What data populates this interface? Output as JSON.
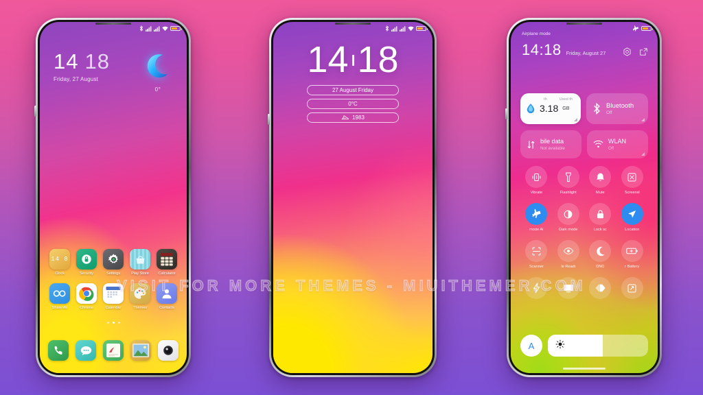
{
  "watermark": {
    "text": "VISIT  FOR  MORE  THEMES  -  MIUITHEMER.COM"
  },
  "statusbar": {
    "bluetooth": "bluetooth-icon",
    "signal1": "signal-icon",
    "signal2": "signal-icon",
    "wifi": "wifi-icon",
    "battery": "battery-icon"
  },
  "phone1": {
    "lockscreen": {
      "hours": "14",
      "minutes": "18",
      "date": "Friday, 27 August",
      "weather_icon": "crescent-moon-icon",
      "temperature": "0°"
    },
    "apps_row1": [
      {
        "label": "Clock",
        "icon": "clock-icon"
      },
      {
        "label": "Security",
        "icon": "security-lock-icon"
      },
      {
        "label": "Settings",
        "icon": "settings-gear-icon"
      },
      {
        "label": "Play Store",
        "icon": "play-store-icon"
      },
      {
        "label": "Calculator",
        "icon": "calculator-icon"
      }
    ],
    "apps_row2": [
      {
        "label": "ShareMe",
        "icon": "shareme-icon"
      },
      {
        "label": "Chrome",
        "icon": "chrome-icon"
      },
      {
        "label": "Calendar",
        "icon": "calendar-icon"
      },
      {
        "label": "Themes",
        "icon": "themes-palette-icon"
      },
      {
        "label": "Contacts",
        "icon": "contacts-icon"
      }
    ],
    "dock": [
      {
        "label": "Phone",
        "icon": "phone-icon"
      },
      {
        "label": "Messages",
        "icon": "messages-icon"
      },
      {
        "label": "Notes",
        "icon": "notes-icon"
      },
      {
        "label": "Gallery",
        "icon": "gallery-icon"
      },
      {
        "label": "Camera",
        "icon": "camera-icon"
      }
    ],
    "page_dots": 3,
    "active_dot": 1
  },
  "phone2": {
    "lockscreen": {
      "hours": "14",
      "minutes": "18",
      "pills": [
        {
          "text": "27 August Friday",
          "icon": ""
        },
        {
          "text": "0°C",
          "icon": ""
        },
        {
          "text": "1983",
          "icon": "steps-shoe-icon"
        }
      ]
    }
  },
  "phone3": {
    "airplane_label": "Airplane mode",
    "time": "14:18",
    "date": "Friday, August 27",
    "header_icons": [
      {
        "name": "settings-gear-icon"
      },
      {
        "name": "edit-icon"
      }
    ],
    "data_tile": {
      "sub_left": "th",
      "sub_right": "Used th",
      "value": "3.18",
      "unit": "GB",
      "icon": "data-droplet-icon"
    },
    "bluetooth_tile": {
      "name": "Bluetooth",
      "state": "Off",
      "icon": "bluetooth-icon"
    },
    "mobile_data_tile": {
      "name": "bile data",
      "state": "Not available",
      "icon": "mobile-data-icon"
    },
    "wlan_tile": {
      "name": "WLAN",
      "state": "Off",
      "icon": "wifi-icon"
    },
    "toggles": [
      {
        "label": "Vibrate",
        "icon": "vibrate-icon",
        "active": false
      },
      {
        "label": "Flashlight",
        "icon": "flashlight-icon",
        "active": false
      },
      {
        "label": "Mute",
        "icon": "bell-mute-icon",
        "active": false
      },
      {
        "label": "Screensl",
        "icon": "screenshot-icon",
        "active": false
      },
      {
        "label": "mode   Ai",
        "icon": "airplane-icon",
        "active": true
      },
      {
        "label": "Dark mode",
        "icon": "dark-mode-icon",
        "active": false
      },
      {
        "label": "Lock sc",
        "icon": "lock-icon",
        "active": false
      },
      {
        "label": "Location",
        "icon": "location-icon",
        "active": true
      },
      {
        "label": "Scanner",
        "icon": "scanner-icon",
        "active": false
      },
      {
        "label": "le    Readi",
        "icon": "eye-reading-icon",
        "active": false
      },
      {
        "label": "DND",
        "icon": "dnd-moon-icon",
        "active": false
      },
      {
        "label": "r   Battery",
        "icon": "battery-saver-icon",
        "active": false
      },
      {
        "label": "",
        "icon": "power-bolt-icon",
        "active": false
      },
      {
        "label": "",
        "icon": "cast-screen-icon",
        "active": false
      },
      {
        "label": "",
        "icon": "contrast-icon",
        "active": false
      },
      {
        "label": "",
        "icon": "expand-icon",
        "active": false
      }
    ],
    "brightness": {
      "auto_label": "A",
      "sun_icon": "sun-icon",
      "level": 55
    }
  }
}
